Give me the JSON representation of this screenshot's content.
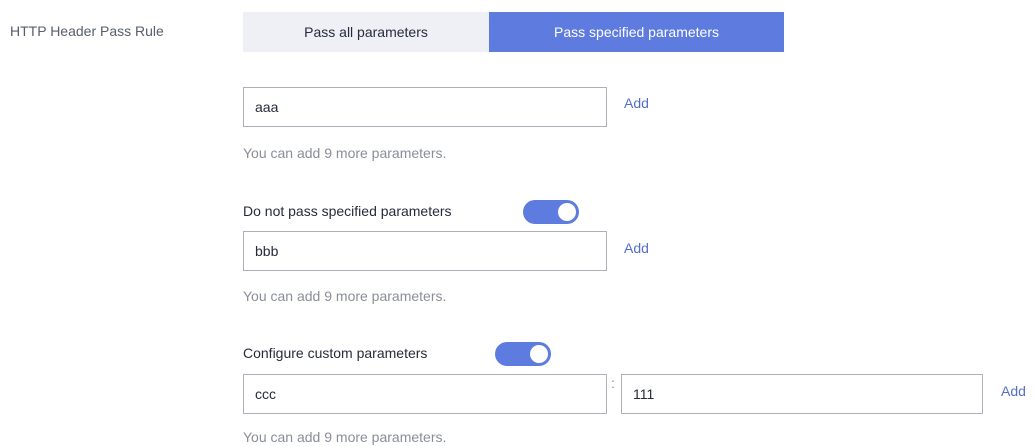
{
  "header_rule": {
    "label": "HTTP Header Pass Rule",
    "options": [
      "Pass all parameters",
      "Pass specified parameters"
    ],
    "selected": "Pass specified parameters"
  },
  "pass_parameters": {
    "input_value": "aaa",
    "add_label": "Add",
    "hint": "You can add 9 more parameters."
  },
  "do_not_pass": {
    "toggle_label": "Do not pass specified parameters",
    "toggle_on": true,
    "input_value": "bbb",
    "add_label": "Add",
    "hint": "You can add 9 more parameters."
  },
  "custom_parameters": {
    "toggle_label": "Configure custom parameters",
    "toggle_on": true,
    "key_value": "ccc",
    "separator": ":",
    "value_value": "111",
    "add_label": "Add",
    "hint": "You can add 9 more parameters."
  },
  "colors": {
    "accent": "#5e7ce0",
    "link": "#526ecc",
    "segment_inactive": "#eef0f5",
    "hint_text": "#8a8e99"
  }
}
